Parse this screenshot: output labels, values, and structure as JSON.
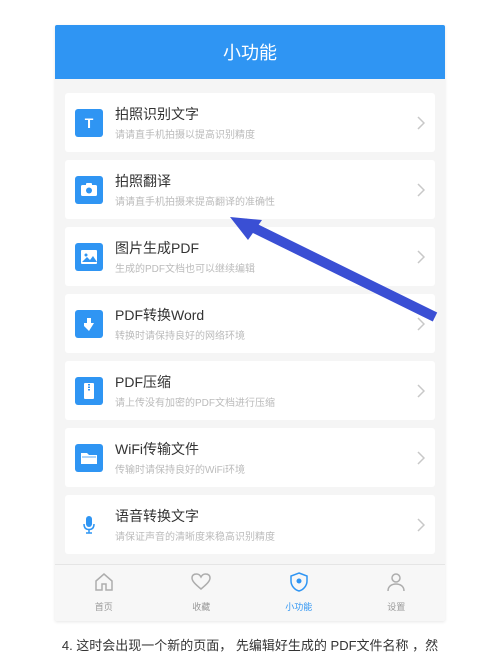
{
  "header": {
    "title": "小功能"
  },
  "colors": {
    "brand": "#2f95f3"
  },
  "items": [
    {
      "icon": "text-T",
      "title": "拍照识别文字",
      "sub": "请请直手机拍摄以提高识别精度"
    },
    {
      "icon": "camera",
      "title": "拍照翻译",
      "sub": "请请直手机拍摄来提高翻译的准确性"
    },
    {
      "icon": "image",
      "title": "图片生成PDF",
      "sub": "生成的PDF文档也可以继续编辑"
    },
    {
      "icon": "pdf",
      "title": "PDF转换Word",
      "sub": "转换时请保持良好的网络环境"
    },
    {
      "icon": "zip",
      "title": "PDF压缩",
      "sub": "请上传没有加密的PDF文档进行压缩"
    },
    {
      "icon": "folder",
      "title": "WiFi传输文件",
      "sub": "传输时请保持良好的WiFi环境"
    },
    {
      "icon": "mic",
      "title": "语音转换文字",
      "sub": "请保证声音的清晰度来稳高识别精度"
    }
  ],
  "tabs": [
    {
      "icon": "home",
      "label": "首页",
      "active": false
    },
    {
      "icon": "heart",
      "label": "收藏",
      "active": false
    },
    {
      "icon": "shield",
      "label": "小功能",
      "active": true
    },
    {
      "icon": "profile",
      "label": "设置",
      "active": false
    }
  ],
  "caption": "4. 这时会出现一个新的页面， 先编辑好生成的  PDF文件名称 ，然"
}
